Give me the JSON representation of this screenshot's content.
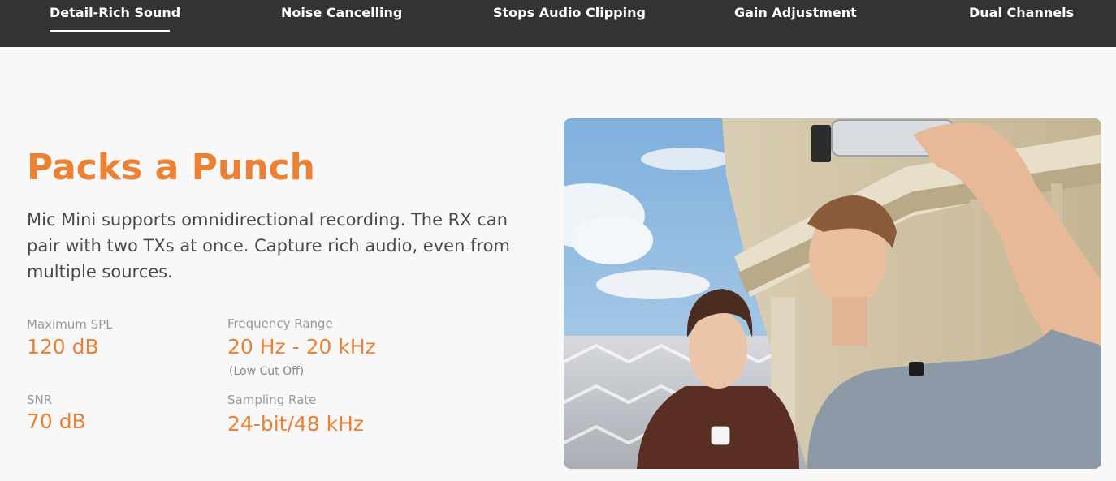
{
  "nav": {
    "tabs": [
      {
        "label": "Detail-Rich Sound",
        "active": true
      },
      {
        "label": "Noise Cancelling",
        "active": false
      },
      {
        "label": "Stops Audio Clipping",
        "active": false
      },
      {
        "label": "Gain Adjustment",
        "active": false
      },
      {
        "label": "Dual Channels",
        "active": false
      }
    ]
  },
  "hero": {
    "headline": "Packs a Punch",
    "description": "Mic Mini supports omnidirectional recording. The RX can pair with two TXs at once. Capture rich audio, even from multiple sources."
  },
  "specs": {
    "max_spl": {
      "label": "Maximum SPL",
      "value": "120 dB"
    },
    "frequency": {
      "label": "Frequency Range",
      "value": "20 Hz - 20 kHz",
      "note": "(Low Cut Off)"
    },
    "snr": {
      "label": "SNR",
      "value": "70 dB"
    },
    "sampling": {
      "label": "Sampling Rate",
      "value": "24-bit/48 kHz"
    }
  },
  "colors": {
    "accent": "#ec8133",
    "nav_background": "#333333",
    "page_background": "#f8f8f8"
  }
}
